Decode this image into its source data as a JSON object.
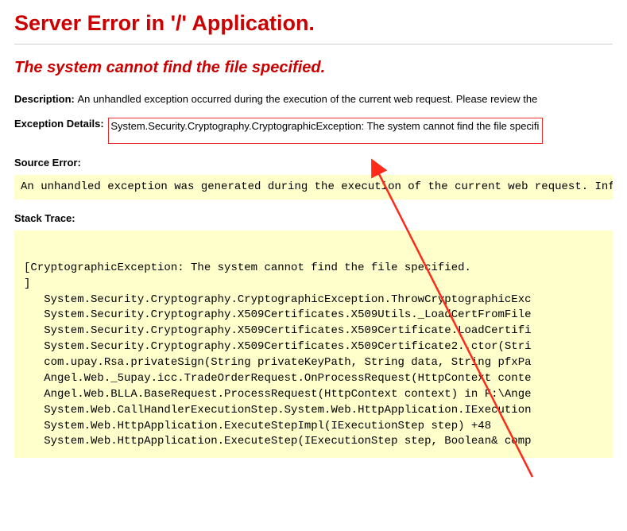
{
  "title": "Server Error in '/' Application.",
  "subtitle": "The system cannot find the file specified.",
  "description_label": "Description: ",
  "description_text": "An unhandled exception occurred during the execution of the current web request. Please review the ",
  "exception_label": "Exception Details: ",
  "exception_text": "System.Security.Cryptography.CryptographicException: The system cannot find the file specifi",
  "source_error_label": "Source Error:",
  "source_error_text": "An unhandled exception was generated during the execution of the current web request. Information",
  "stack_trace_label": "Stack Trace:",
  "stack_lines": [
    "",
    "[CryptographicException: The system cannot find the file specified.",
    "]",
    "   System.Security.Cryptography.CryptographicException.ThrowCryptographicExc",
    "   System.Security.Cryptography.X509Certificates.X509Utils._LoadCertFromFile",
    "   System.Security.Cryptography.X509Certificates.X509Certificate.LoadCertifi",
    "   System.Security.Cryptography.X509Certificates.X509Certificate2..ctor(Stri",
    "   com.upay.Rsa.privateSign(String privateKeyPath, String data, String pfxPa",
    "   Angel.Web._5upay.icc.TradeOrderRequest.OnProcessRequest(HttpContext conte",
    "   Angel.Web.BLLA.BaseRequest.ProcessRequest(HttpContext context) in F:\\Ange",
    "   System.Web.CallHandlerExecutionStep.System.Web.HttpApplication.IExecution",
    "   System.Web.HttpApplication.ExecuteStepImpl(IExecutionStep step) +48",
    "   System.Web.HttpApplication.ExecuteStep(IExecutionStep step, Boolean& comp"
  ]
}
